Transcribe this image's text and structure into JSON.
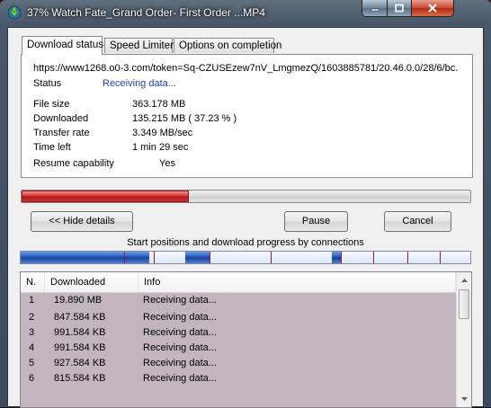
{
  "window": {
    "title": "37% Watch Fate_Grand Order- First Order ...MP4"
  },
  "tabs": [
    {
      "label": "Download status"
    },
    {
      "label": "Speed Limiter"
    },
    {
      "label": "Options on completion"
    }
  ],
  "status": {
    "url": "https://www1268.o0-3.com/token=Sq-CZUSEzew7nV_LmgmezQ/1603885781/20.46.0.0/28/6/bc.",
    "status_label": "Status",
    "status_value": "Receiving data...",
    "file_size_label": "File size",
    "file_size_value": "363.178  MB",
    "downloaded_label": "Downloaded",
    "downloaded_value": "135.215  MB  ( 37.23 % )",
    "transfer_rate_label": "Transfer rate",
    "transfer_rate_value": "3.349  MB/sec",
    "time_left_label": "Time left",
    "time_left_value": "1 min 29 sec",
    "resume_label": "Resume capability",
    "resume_value": "Yes"
  },
  "progress": {
    "fraction": 0.3723
  },
  "buttons": {
    "hide_details": "<< Hide details",
    "pause": "Pause",
    "cancel": "Cancel"
  },
  "connections": {
    "label": "Start positions and download progress by connections"
  },
  "list": {
    "headers": {
      "n": "N.",
      "downloaded": "Downloaded",
      "info": "Info"
    },
    "rows": [
      {
        "n": "1",
        "downloaded": "19.890  MB",
        "info": "Receiving data..."
      },
      {
        "n": "2",
        "downloaded": "847.584  KB",
        "info": "Receiving data..."
      },
      {
        "n": "3",
        "downloaded": "991.584  KB",
        "info": "Receiving data..."
      },
      {
        "n": "4",
        "downloaded": "991.584  KB",
        "info": "Receiving data..."
      },
      {
        "n": "5",
        "downloaded": "927.584  KB",
        "info": "Receiving data..."
      },
      {
        "n": "6",
        "downloaded": "815.584  KB",
        "info": "Receiving data..."
      }
    ]
  },
  "colors": {
    "progress_red": "#c82828",
    "connection_blue": "#1d4fb8",
    "row_background": "#c3b5bd",
    "status_link": "#1f3fb8"
  }
}
